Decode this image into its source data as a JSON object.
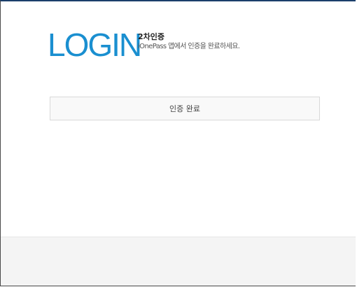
{
  "header": {
    "logo_text": "LOGIN",
    "subtitle": "2차인증",
    "description": "iOnePass 앱에서 인증을 완료하세요."
  },
  "actions": {
    "confirm_label": "인증 완료"
  },
  "colors": {
    "brand": "#1a8fd0",
    "window_top_border": "#1b3f6b",
    "footer_background": "#f4f4f4"
  }
}
